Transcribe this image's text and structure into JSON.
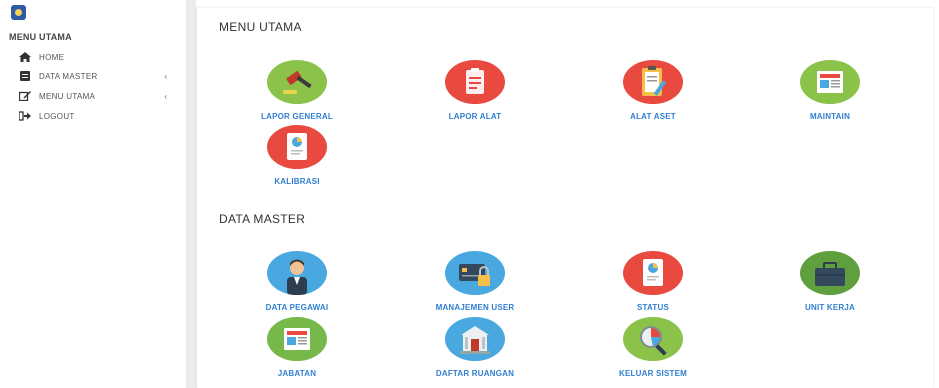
{
  "sidebar": {
    "heading": "MENU UTAMA",
    "items": [
      {
        "label": "HOME",
        "icon": "home-icon"
      },
      {
        "label": "DATA MASTER",
        "icon": "database-icon",
        "chevron": "‹"
      },
      {
        "label": "MENU UTAMA",
        "icon": "edit-icon",
        "chevron": "‹"
      },
      {
        "label": "LOGOUT",
        "icon": "logout-icon"
      }
    ]
  },
  "main": {
    "section1": {
      "title": "MENU UTAMA",
      "tiles": [
        {
          "label": "LAPOR GENERAL",
          "icon": "gavel-icon",
          "color": "#8bc34a"
        },
        {
          "label": "LAPOR ALAT",
          "icon": "clipboard-icon",
          "color": "#e84a3f"
        },
        {
          "label": "ALAT ASET",
          "icon": "clipboard-pencil-icon",
          "color": "#e84a3f"
        },
        {
          "label": "MAINTAIN",
          "icon": "newspaper-icon",
          "color": "#8bc34a"
        },
        {
          "label": "KALIBRASI",
          "icon": "report-chart-icon",
          "color": "#e84a3f"
        }
      ]
    },
    "section2": {
      "title": "DATA MASTER",
      "tiles": [
        {
          "label": "DATA PEGAWAI",
          "icon": "employee-icon",
          "color": "#4aa8e0"
        },
        {
          "label": "MANAJEMEN USER",
          "icon": "card-lock-icon",
          "color": "#4aa8e0"
        },
        {
          "label": "STATUS",
          "icon": "report-chart-icon",
          "color": "#e84a3f"
        },
        {
          "label": "UNIT KERJA",
          "icon": "briefcase-icon",
          "color": "#5f9f3e"
        },
        {
          "label": "JABATAN",
          "icon": "newspaper-icon",
          "color": "#77b84a"
        },
        {
          "label": "DAFTAR RUANGAN",
          "icon": "building-icon",
          "color": "#4aa8e0"
        },
        {
          "label": "KELUAR SISTEM",
          "icon": "pie-magnifier-icon",
          "color": "#8bc34a"
        }
      ]
    }
  }
}
